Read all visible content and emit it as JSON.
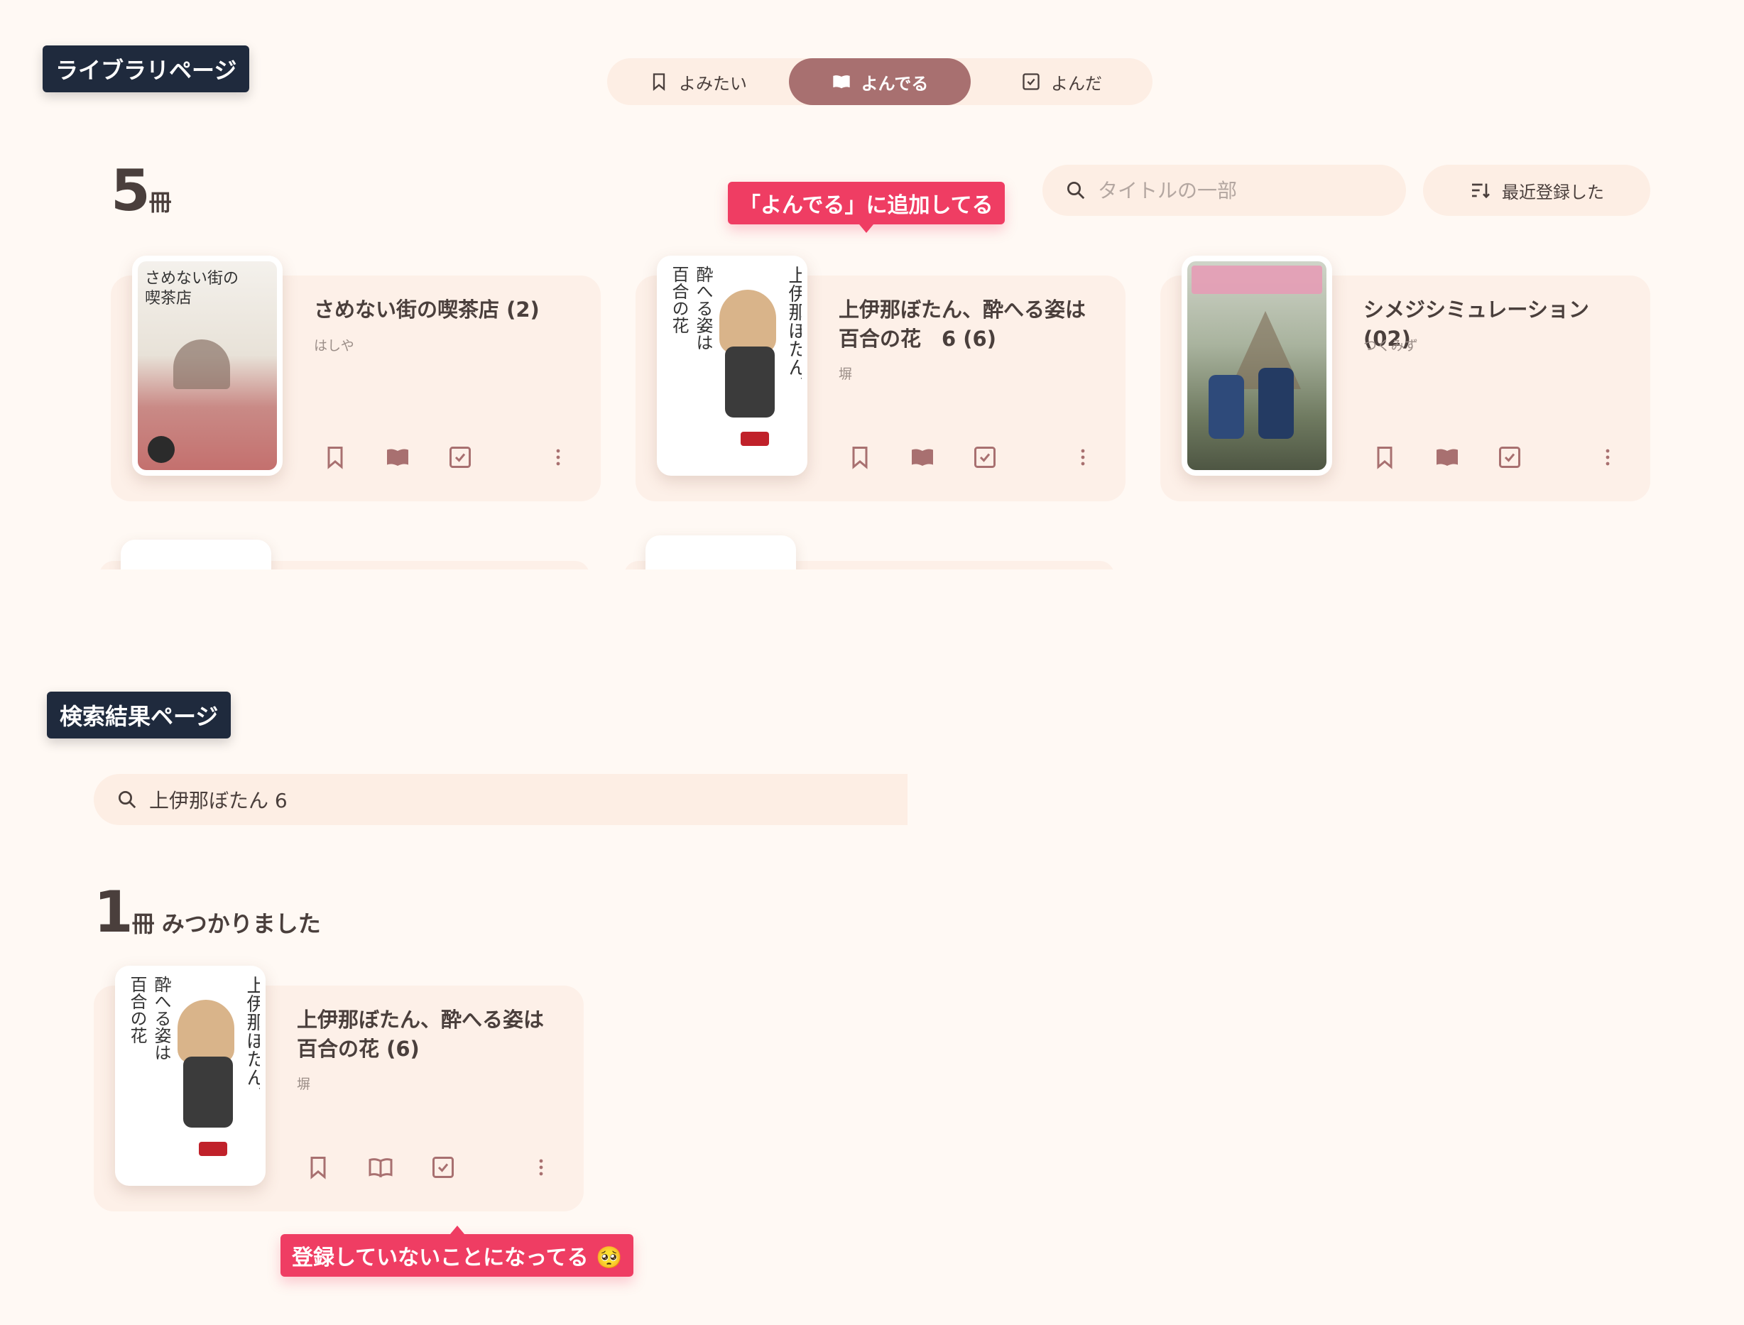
{
  "colors": {
    "background": "#fff9f4",
    "card": "#fdf0e8",
    "accent": "#a87070",
    "label_bg": "#1f2a3d",
    "tooltip": "#ef3d63"
  },
  "library": {
    "label": "ライブラリページ",
    "tabs": [
      {
        "label": "よみたい",
        "icon": "bookmark-icon",
        "active": false
      },
      {
        "label": "よんでる",
        "icon": "open-book-icon",
        "active": true
      },
      {
        "label": "よんだ",
        "icon": "checkbox-icon",
        "active": false
      }
    ],
    "count_num": "5",
    "count_unit": "冊",
    "search_placeholder": "タイトルの一部",
    "sort_label": "最近登録した",
    "tooltip": "「よんでる」に追加してる",
    "books": [
      {
        "title": "さめない街の喫茶店 (2)",
        "author": "はしや",
        "reading": true
      },
      {
        "title": "上伊那ぼたん、酔へる姿は百合の花　6 (6)",
        "author": "塀",
        "reading": true
      },
      {
        "title": "シメジシミュレーション (02)",
        "author": "つくみず",
        "reading": true
      }
    ]
  },
  "search_page": {
    "label": "検索結果ページ",
    "query": "上伊那ぼたん 6",
    "count_num": "1",
    "count_unit": "冊",
    "count_suffix": "みつかりました",
    "tooltip": "登録していないことになってる 🥺",
    "results": [
      {
        "title": "上伊那ぼたん、酔へる姿は百合の花 (6)",
        "author": "塀",
        "reading": false
      }
    ]
  }
}
